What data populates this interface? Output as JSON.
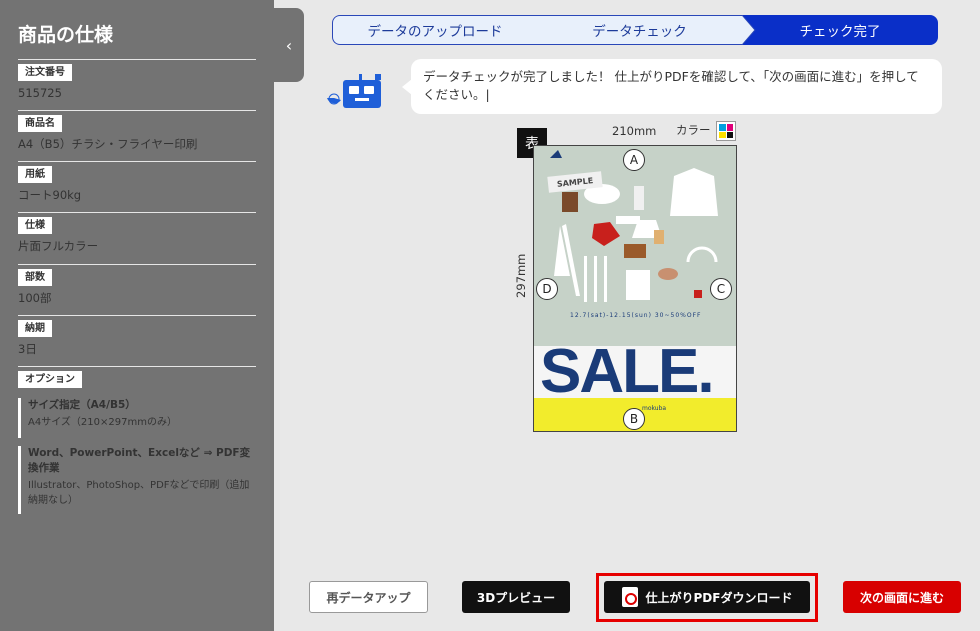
{
  "sidebar": {
    "title": "商品の仕様",
    "specs": [
      {
        "label": "注文番号",
        "value": "515725"
      },
      {
        "label": "商品名",
        "value": "A4（B5）チラシ・フライヤー印刷"
      },
      {
        "label": "用紙",
        "value": "コート90kg"
      },
      {
        "label": "仕様",
        "value": "片面フルカラー"
      },
      {
        "label": "部数",
        "value": "100部"
      },
      {
        "label": "納期",
        "value": "3日"
      }
    ],
    "option_label": "オプション",
    "options": [
      {
        "title": "サイズ指定（A4/B5）",
        "desc": "A4サイズ（210×297mmのみ）"
      },
      {
        "title": "Word、PowerPoint、Excelなど ⇒ PDF変換作業",
        "desc": "Illustrator、PhotoShop、PDFなどで印刷（追加納期なし）"
      }
    ],
    "collapse_icon": "chevron-left-icon",
    "collapse_glyph": "‹"
  },
  "steps": [
    {
      "label": "データのアップロード",
      "state": "done"
    },
    {
      "label": "データチェック",
      "state": "done"
    },
    {
      "label": "チェック完了",
      "state": "current"
    }
  ],
  "message": "データチェックが完了しました！ 仕上がりPDFを確認して、「次の画面に進む」を押してください。|",
  "preview": {
    "face_label": "表",
    "width_label": "210mm",
    "height_label": "297mm",
    "color_label": "カラー",
    "markers": [
      "A",
      "B",
      "C",
      "D"
    ],
    "poster": {
      "sample_text": "SAMPLE",
      "sale_text": "SALE.",
      "dates_text": "12.7(sat)-12.15(sun)   30~50%OFF",
      "logo_text": "mokuba"
    }
  },
  "buttons": {
    "reupload": "再データアップ",
    "preview_3d": "3Dプレビュー",
    "download_pdf": "仕上がりPDFダウンロード",
    "next": "次の画面に進む"
  },
  "colors": {
    "accent": "#0a2fc8",
    "sidebar_bg": "#737373",
    "next_button": "#d80000",
    "highlight_frame": "#e60000"
  }
}
